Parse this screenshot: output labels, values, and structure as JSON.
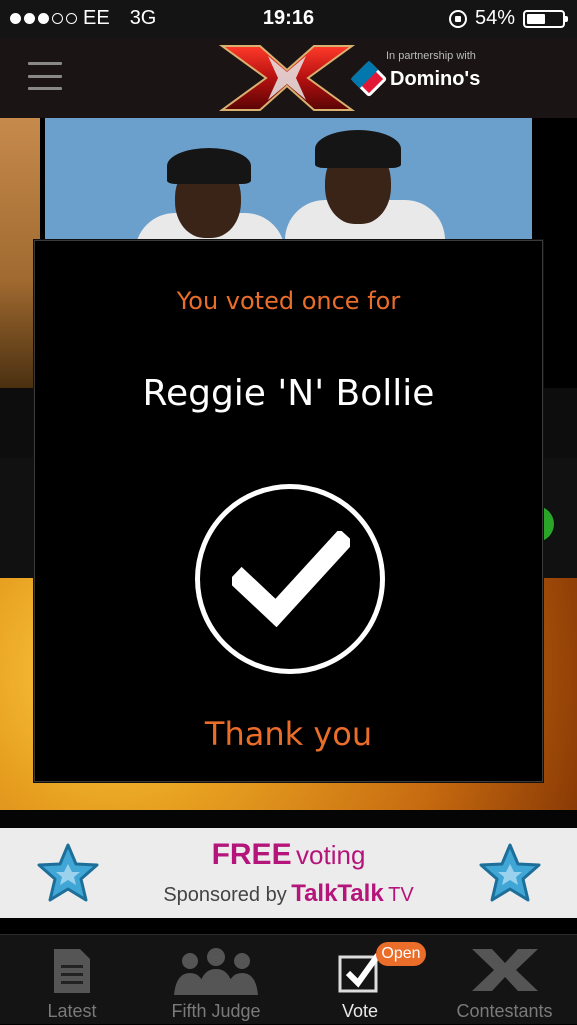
{
  "status_bar": {
    "carrier": "EE",
    "network": "3G",
    "time": "19:16",
    "battery_percent": "54%",
    "battery_level": 0.54,
    "signal_bars_filled": 3,
    "signal_bars_total": 5
  },
  "header": {
    "partner_text": "In partnership with",
    "partner_name": "Domino's",
    "logo_icon": "x-factor-logo",
    "menu_icon": "hamburger-menu-icon"
  },
  "modal": {
    "voted_text": "You voted once for",
    "contestant": "Reggie 'N' Bollie",
    "confirm_icon": "checkmark-circle-icon",
    "thanks_text": "Thank you",
    "accent_color": "#ea6d2a"
  },
  "banner": {
    "free": "FREE",
    "voting": "voting",
    "sponsored_by": "Sponsored by",
    "sponsor": "TalkTalk",
    "sponsor_suffix": "TV",
    "brand_color": "#b5157a"
  },
  "tabs": [
    {
      "label": "Latest",
      "icon": "document-icon",
      "active": false
    },
    {
      "label": "Fifth Judge",
      "icon": "crowd-icon",
      "active": false
    },
    {
      "label": "Vote",
      "icon": "vote-checkbox-icon",
      "active": true,
      "badge": "Open"
    },
    {
      "label": "Contestants",
      "icon": "x-contestants-icon",
      "active": false
    }
  ]
}
